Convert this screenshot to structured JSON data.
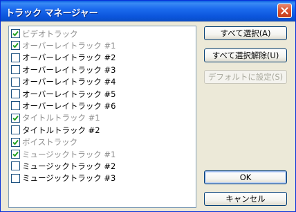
{
  "window": {
    "title": "トラック マネージャー"
  },
  "tracks": [
    {
      "label": "ビデオトラック",
      "checked": true,
      "dim": true
    },
    {
      "label": "オーバーレイトラック #1",
      "checked": true,
      "dim": true
    },
    {
      "label": "オーバーレイトラック #2",
      "checked": false,
      "dim": false
    },
    {
      "label": "オーバーレイトラック #3",
      "checked": false,
      "dim": false
    },
    {
      "label": "オーバーレイトラック #4",
      "checked": false,
      "dim": false
    },
    {
      "label": "オーバーレイトラック #5",
      "checked": false,
      "dim": false
    },
    {
      "label": "オーバーレイトラック #6",
      "checked": false,
      "dim": false
    },
    {
      "label": "タイトルトラック #1",
      "checked": true,
      "dim": true
    },
    {
      "label": "タイトルトラック #2",
      "checked": false,
      "dim": false
    },
    {
      "label": "ボイストラック",
      "checked": true,
      "dim": true
    },
    {
      "label": "ミュージックトラック #1",
      "checked": true,
      "dim": true
    },
    {
      "label": "ミュージックトラック #2",
      "checked": false,
      "dim": false
    },
    {
      "label": "ミュージックトラック #3",
      "checked": false,
      "dim": false
    }
  ],
  "buttons": {
    "select_all": "すべて選択(A)",
    "deselect_all": "すべて選択解除(U)",
    "set_default": "デフォルトに設定(S)",
    "ok": "OK",
    "cancel": "キャンセル"
  },
  "colors": {
    "check": "#21a121",
    "disabled_text": "#8c8c8c"
  }
}
